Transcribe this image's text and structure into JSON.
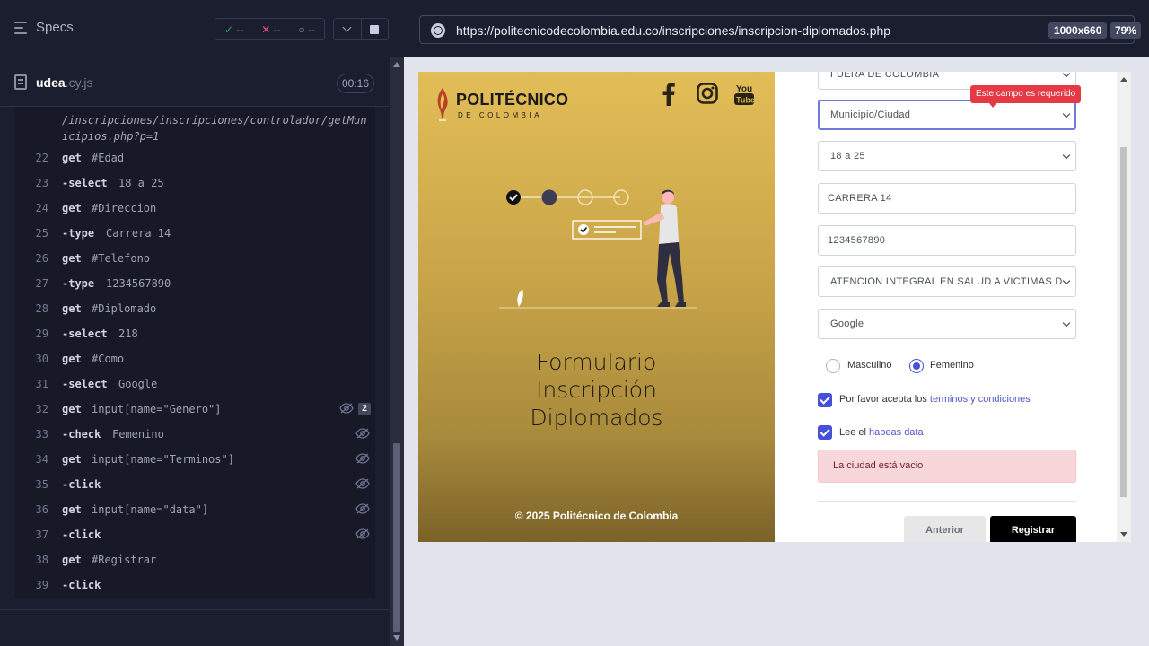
{
  "reporter": {
    "specs_label": "Specs",
    "stats": {
      "passed": "--",
      "failed": "--",
      "pending": "--"
    },
    "spec": {
      "name": "udea",
      "ext": ".cy.js",
      "duration": "00:16"
    },
    "url_fragment": "/inscripciones/inscripciones/controlador/getMunicipios.php?p=1",
    "commands": [
      {
        "num": "22",
        "name": "get",
        "message": "#Edad",
        "child": false
      },
      {
        "num": "23",
        "name": "-select",
        "message": "18 a 25",
        "child": true
      },
      {
        "num": "24",
        "name": "get",
        "message": "#Direccion",
        "child": false
      },
      {
        "num": "25",
        "name": "-type",
        "message": "Carrera 14",
        "child": true
      },
      {
        "num": "26",
        "name": "get",
        "message": "#Telefono",
        "child": false
      },
      {
        "num": "27",
        "name": "-type",
        "message": "1234567890",
        "child": true
      },
      {
        "num": "28",
        "name": "get",
        "message": "#Diplomado",
        "child": false
      },
      {
        "num": "29",
        "name": "-select",
        "message": "218",
        "child": true
      },
      {
        "num": "30",
        "name": "get",
        "message": "#Como",
        "child": false
      },
      {
        "num": "31",
        "name": "-select",
        "message": "Google",
        "child": true
      },
      {
        "num": "32",
        "name": "get",
        "message": "input[name=\"Genero\"]",
        "child": false,
        "hidden": true,
        "badge": "2"
      },
      {
        "num": "33",
        "name": "-check",
        "message": "Femenino",
        "child": true,
        "hidden": true
      },
      {
        "num": "34",
        "name": "get",
        "message": "input[name=\"Terminos\"]",
        "child": false,
        "hidden": true
      },
      {
        "num": "35",
        "name": "-click",
        "message": "",
        "child": true,
        "hidden": true
      },
      {
        "num": "36",
        "name": "get",
        "message": "input[name=\"data\"]",
        "child": false,
        "hidden": true
      },
      {
        "num": "37",
        "name": "-click",
        "message": "",
        "child": true,
        "hidden": true
      },
      {
        "num": "38",
        "name": "get",
        "message": "#Registrar",
        "child": false
      },
      {
        "num": "39",
        "name": "-click",
        "message": "",
        "child": true
      }
    ]
  },
  "aut": {
    "url": "https://politecnicodecolombia.edu.co/inscripciones/inscripcion-diplomados.php",
    "viewport": "1000x660",
    "zoom": "79%"
  },
  "site": {
    "logo_main": "POLITÉCNICO",
    "logo_sub": "DE COLOMBIA",
    "hero_title_1": "Formulario",
    "hero_title_2": "Inscripción",
    "hero_title_3": "Diplomados",
    "copyright": "© 2025 Politécnico de Colombia",
    "social_icons": [
      "facebook-icon",
      "instagram-icon",
      "youtube-icon"
    ],
    "youtube_you": "You",
    "youtube_tube": "Tube",
    "form": {
      "pais": "FUERA DE COLOMBIA",
      "municipio": "Municipio/Ciudad",
      "tooltip": "Este campo es requerido",
      "edad": "18 a 25",
      "direccion": "CARRERA 14",
      "telefono": "1234567890",
      "diplomado": "ATENCION INTEGRAL EN SALUD A VICTIMAS D",
      "como": "Google",
      "genero_masculino": "Masculino",
      "genero_femenino": "Femenino",
      "terminos_text": "Por favor acepta los",
      "terminos_link": "terminos y condiciones",
      "habeas_text": "Lee el",
      "habeas_link": "habeas data",
      "alert": "La ciudad está vacio",
      "btn_prev": "Anterior",
      "btn_register": "Registrar"
    }
  },
  "colors": {
    "accent": "#4750d8",
    "error": "#e53a45",
    "hero_gold": "#e2bd57",
    "cypress_bg": "#1b1e2e"
  }
}
